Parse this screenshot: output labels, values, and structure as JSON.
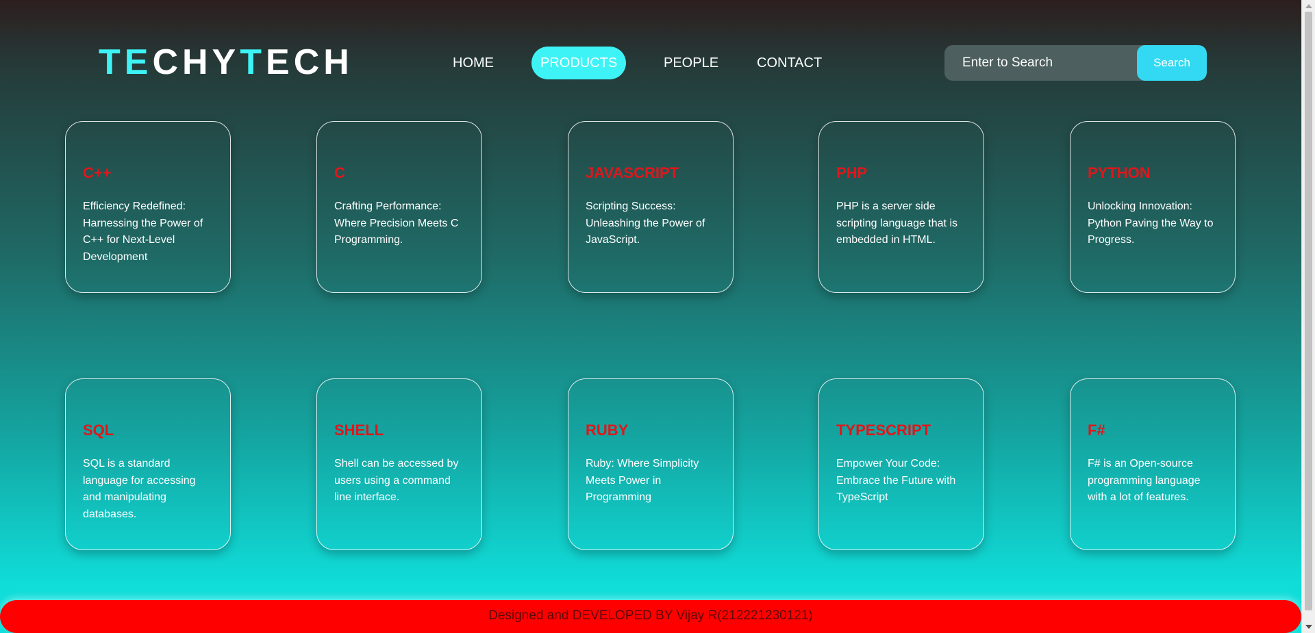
{
  "header": {
    "logo": [
      {
        "text": "TE",
        "color": "#3ef3f6"
      },
      {
        "text": "CHY",
        "color": "#ffffff"
      },
      {
        "text": "T",
        "color": "#3ef3f6"
      },
      {
        "text": "ECH",
        "color": "#ffffff"
      }
    ],
    "nav": [
      {
        "label": "HOME",
        "active": false
      },
      {
        "label": "PRODUCTS",
        "active": true
      },
      {
        "label": "PEOPLE",
        "active": false
      },
      {
        "label": "CONTACT",
        "active": false
      }
    ],
    "search": {
      "placeholder": "Enter to Search",
      "button_label": "Search"
    }
  },
  "cards": [
    {
      "title": "C++",
      "description": "Efficiency Redefined: Harnessing the Power of C++ for Next-Level Development"
    },
    {
      "title": "C",
      "description": "Crafting Performance: Where Precision Meets C Programming."
    },
    {
      "title": "JAVASCRIPT",
      "description": "Scripting Success: Unleashing the Power of JavaScript."
    },
    {
      "title": "PHP",
      "description": "PHP is a server side scripting language that is embedded in HTML."
    },
    {
      "title": "PYTHON",
      "description": "Unlocking Innovation: Python Paving the Way to Progress."
    },
    {
      "title": "SQL",
      "description": "SQL is a standard language for accessing and manipulating databases."
    },
    {
      "title": "SHELL",
      "description": "Shell can be accessed by users using a command line interface."
    },
    {
      "title": "RUBY",
      "description": "Ruby: Where Simplicity Meets Power in Programming"
    },
    {
      "title": "TYPESCRIPT",
      "description": "Empower Your Code: Embrace the Future with TypeScript"
    },
    {
      "title": "F#",
      "description": "F# is an Open-source programming language with a lot of features."
    }
  ],
  "footer": {
    "text": "Designed and DEVELOPED BY Vijay R(212221230121)"
  },
  "colors": {
    "accent": "#3ef3f6",
    "card_title": "#e0161b",
    "footer_bg": "#ff0000",
    "search_button": "#33d9f2"
  }
}
